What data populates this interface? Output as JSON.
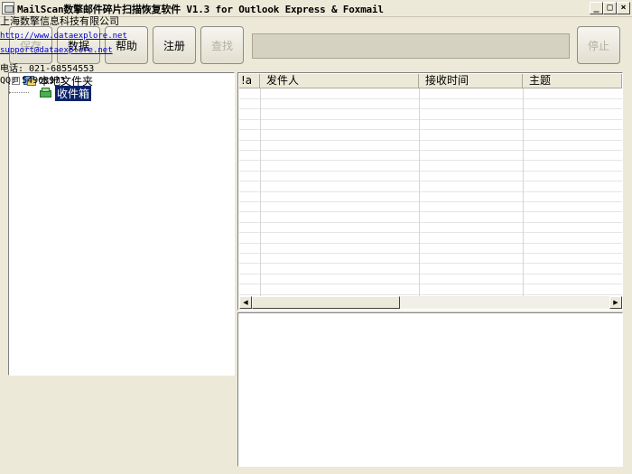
{
  "window": {
    "title": "MailScan数擎邮件碎片扫描恢复软件 V1.3  for Outlook Express & Foxmail",
    "minimize": "_",
    "maximize": "□",
    "close": "×"
  },
  "toolbar": {
    "save_label": "保存",
    "data_label": "数据",
    "help_label": "帮助",
    "register_label": "注册",
    "find_label": "查找",
    "stop_label": "停止"
  },
  "tree": {
    "root_label": "本地文件夹",
    "root_expander": "⊟",
    "inbox_label": "收件箱"
  },
  "list": {
    "columns": [
      "!a",
      "发件人",
      "接收时间",
      "主题"
    ]
  },
  "info": {
    "company": "上海数擎信息科技有限公司",
    "website": "http://www.dataexplore.net",
    "email": "support@dataexplore.net",
    "phone": "电话: 021-68554553",
    "qq": "QQ: 54968973"
  },
  "scrollbar": {
    "left_arrow": "◀",
    "right_arrow": "▶"
  }
}
